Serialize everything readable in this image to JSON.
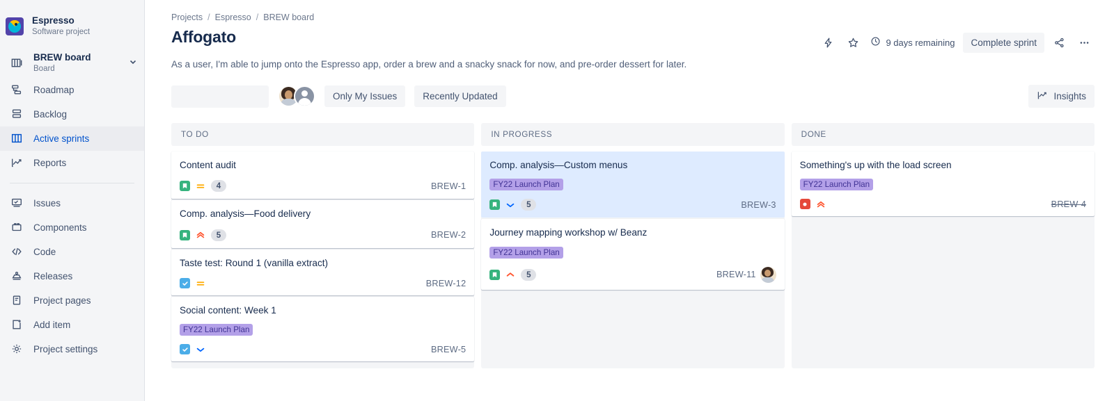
{
  "sidebar": {
    "project": {
      "name": "Espresso",
      "type": "Software project",
      "logo_color": "#5243aa"
    },
    "board": {
      "name": "BREW board",
      "sub": "Board"
    },
    "items_top": [
      {
        "label": "Roadmap",
        "icon": "roadmap-icon",
        "active": false
      },
      {
        "label": "Backlog",
        "icon": "backlog-icon",
        "active": false
      },
      {
        "label": "Active sprints",
        "icon": "board-columns-icon",
        "active": true
      },
      {
        "label": "Reports",
        "icon": "reports-icon",
        "active": false
      }
    ],
    "items_bottom": [
      {
        "label": "Issues",
        "icon": "issues-icon"
      },
      {
        "label": "Components",
        "icon": "components-icon"
      },
      {
        "label": "Code",
        "icon": "code-icon"
      },
      {
        "label": "Releases",
        "icon": "releases-icon"
      },
      {
        "label": "Project pages",
        "icon": "project-pages-icon"
      },
      {
        "label": "Add item",
        "icon": "add-item-icon"
      },
      {
        "label": "Project settings",
        "icon": "gear-icon"
      }
    ]
  },
  "header": {
    "breadcrumbs": [
      "Projects",
      "Espresso",
      "BREW board"
    ],
    "separator": "/",
    "title": "Affogato",
    "subtitle": "As a user, I'm able to jump onto the Espresso app, order a brew and a snacky snack for now, and pre-order dessert for later.",
    "days_remaining": "9 days remaining",
    "complete_sprint_label": "Complete sprint"
  },
  "toolbar": {
    "search_placeholder": "",
    "search_value": "",
    "only_my_issues": "Only My Issues",
    "recently_updated": "Recently Updated",
    "insights": "Insights"
  },
  "board": {
    "columns": [
      {
        "name": "TO DO",
        "cards": [
          {
            "title": "Content audit",
            "epic": null,
            "type": "story",
            "priority": "medium",
            "points": "4",
            "key": "BREW-1",
            "selected": false,
            "done": false,
            "avatar": false
          },
          {
            "title": "Comp. analysis—Food delivery",
            "epic": null,
            "type": "story",
            "priority": "highest",
            "points": "5",
            "key": "BREW-2",
            "selected": false,
            "done": false,
            "avatar": false
          },
          {
            "title": "Taste test: Round 1 (vanilla extract)",
            "epic": null,
            "type": "task",
            "priority": "medium",
            "points": null,
            "key": "BREW-12",
            "selected": false,
            "done": false,
            "avatar": false
          },
          {
            "title": "Social content: Week 1",
            "epic": "FY22 Launch Plan",
            "type": "task",
            "priority": "low",
            "points": null,
            "key": "BREW-5",
            "selected": false,
            "done": false,
            "avatar": false
          }
        ]
      },
      {
        "name": "IN PROGRESS",
        "cards": [
          {
            "title": "Comp. analysis—Custom menus",
            "epic": "FY22 Launch Plan",
            "type": "story",
            "priority": "low",
            "points": "5",
            "key": "BREW-3",
            "selected": true,
            "done": false,
            "avatar": false
          },
          {
            "title": "Journey mapping workshop w/ Beanz",
            "epic": "FY22 Launch Plan",
            "type": "story",
            "priority": "high",
            "points": "5",
            "key": "BREW-11",
            "selected": false,
            "done": false,
            "avatar": true
          }
        ]
      },
      {
        "name": "DONE",
        "cards": [
          {
            "title": "Something's up with the load screen",
            "epic": "FY22 Launch Plan",
            "type": "bug",
            "priority": "highest",
            "points": null,
            "key": "BREW-4",
            "selected": false,
            "done": true,
            "avatar": false
          }
        ]
      }
    ]
  },
  "colors": {
    "accent": "#0052cc",
    "epic_bg": "#b3a0e8",
    "epic_text": "#403294",
    "story": "#36b37e",
    "task": "#4bade8",
    "bug": "#e5493a",
    "priority_high": "#ff5630",
    "priority_medium": "#ffab00",
    "priority_low": "#0065ff",
    "selected_card": "#deebff",
    "surface": "#f4f5f7"
  }
}
